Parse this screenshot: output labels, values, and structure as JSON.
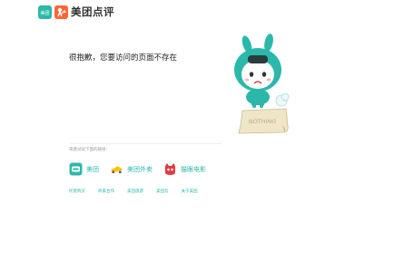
{
  "header": {
    "brand": "美团点评",
    "meituan_logo_text": "美团",
    "dianping_logo_icon": "dianping-icon"
  },
  "error": {
    "message": "很抱歉，您要访问的页面不存在"
  },
  "mascot": {
    "sign_text": "NOTHING"
  },
  "hint": "或者试试下面的链接：",
  "apps": [
    {
      "label": "美团",
      "icon": "meituan-app-icon"
    },
    {
      "label": "美团外卖",
      "icon": "waimai-scooter-icon"
    },
    {
      "label": "猫眼电影",
      "icon": "maoyan-cat-icon"
    }
  ],
  "links": [
    {
      "label": "托管购买"
    },
    {
      "label": "商家合作"
    },
    {
      "label": "美团旅游"
    },
    {
      "label": "美团云"
    },
    {
      "label": "关于美团"
    }
  ],
  "colors": {
    "accent": "#2bb8aa",
    "dianping": "#ff6633",
    "maoyan": "#e4393c",
    "waimai": "#ffc300"
  }
}
